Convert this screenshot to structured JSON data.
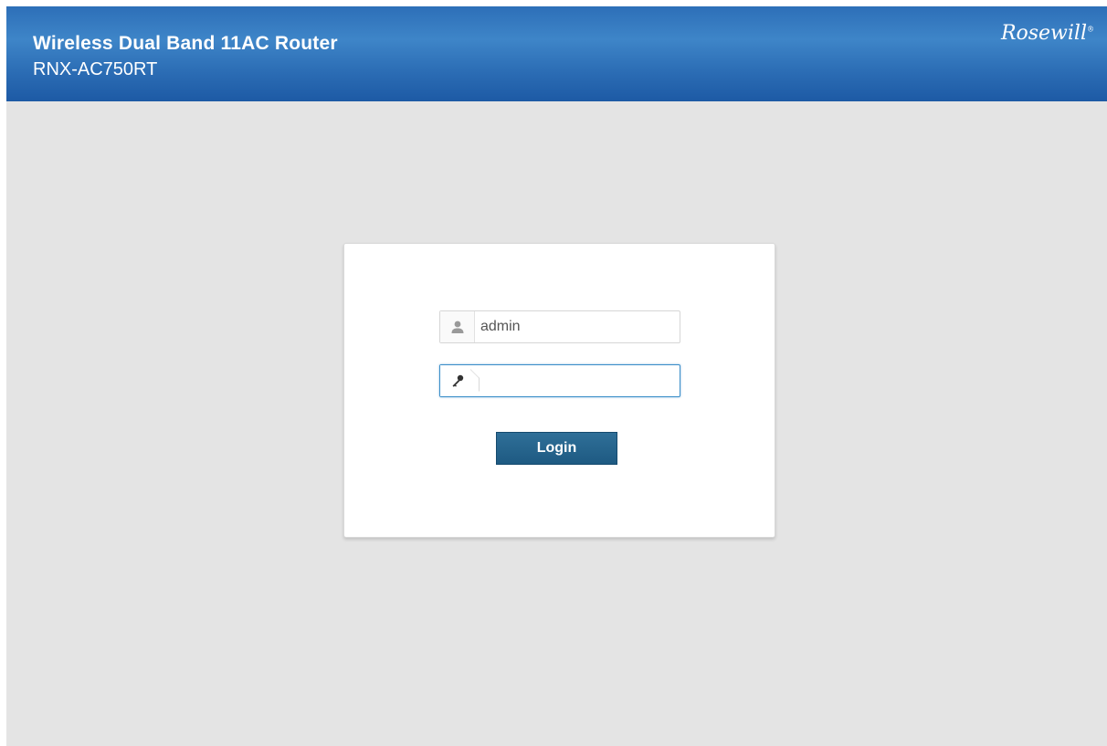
{
  "header": {
    "title": "Wireless Dual Band 11AC Router",
    "model": "RNX-AC750RT",
    "brand": "Rosewill",
    "colors": {
      "gradient_top": "#2d6fb8",
      "gradient_bottom": "#1d5aa5"
    }
  },
  "login": {
    "username": {
      "value": "admin",
      "icon": "user-icon"
    },
    "password": {
      "value": "",
      "icon": "key-icon"
    },
    "button_label": "Login",
    "button_color": "#1e5a82"
  },
  "background_color": "#e4e4e4"
}
